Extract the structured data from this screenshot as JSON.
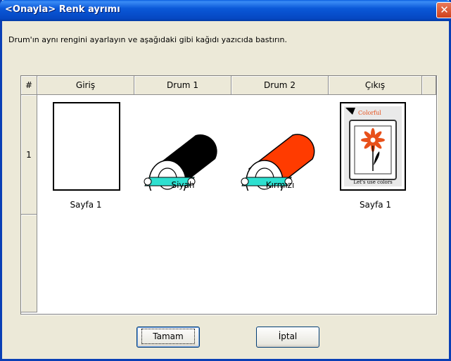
{
  "window": {
    "title": "<Onayla> Renk ayrımı",
    "close_symbol": "✕"
  },
  "instruction": "Drum'ın aynı rengini ayarlayın ve aşağıdaki gibi kağıdı yazıcıda bastırın.",
  "table": {
    "headers": [
      "#",
      "Giriş",
      "Drum 1",
      "Drum 2",
      "Çıkış"
    ],
    "row_number": "1",
    "cells": {
      "input_caption": "Sayfa 1",
      "drum1_caption": "Siyah",
      "drum2_caption": "Kırmızı",
      "output_caption": "Sayfa 1"
    },
    "drum1_color": "#000000",
    "drum2_color": "#ff3b00",
    "output_image": {
      "line1": "Colorful",
      "line2": "Let's use colors",
      "flower_color": "#e8501a"
    }
  },
  "buttons": {
    "ok": "Tamam",
    "cancel": "İptal"
  }
}
